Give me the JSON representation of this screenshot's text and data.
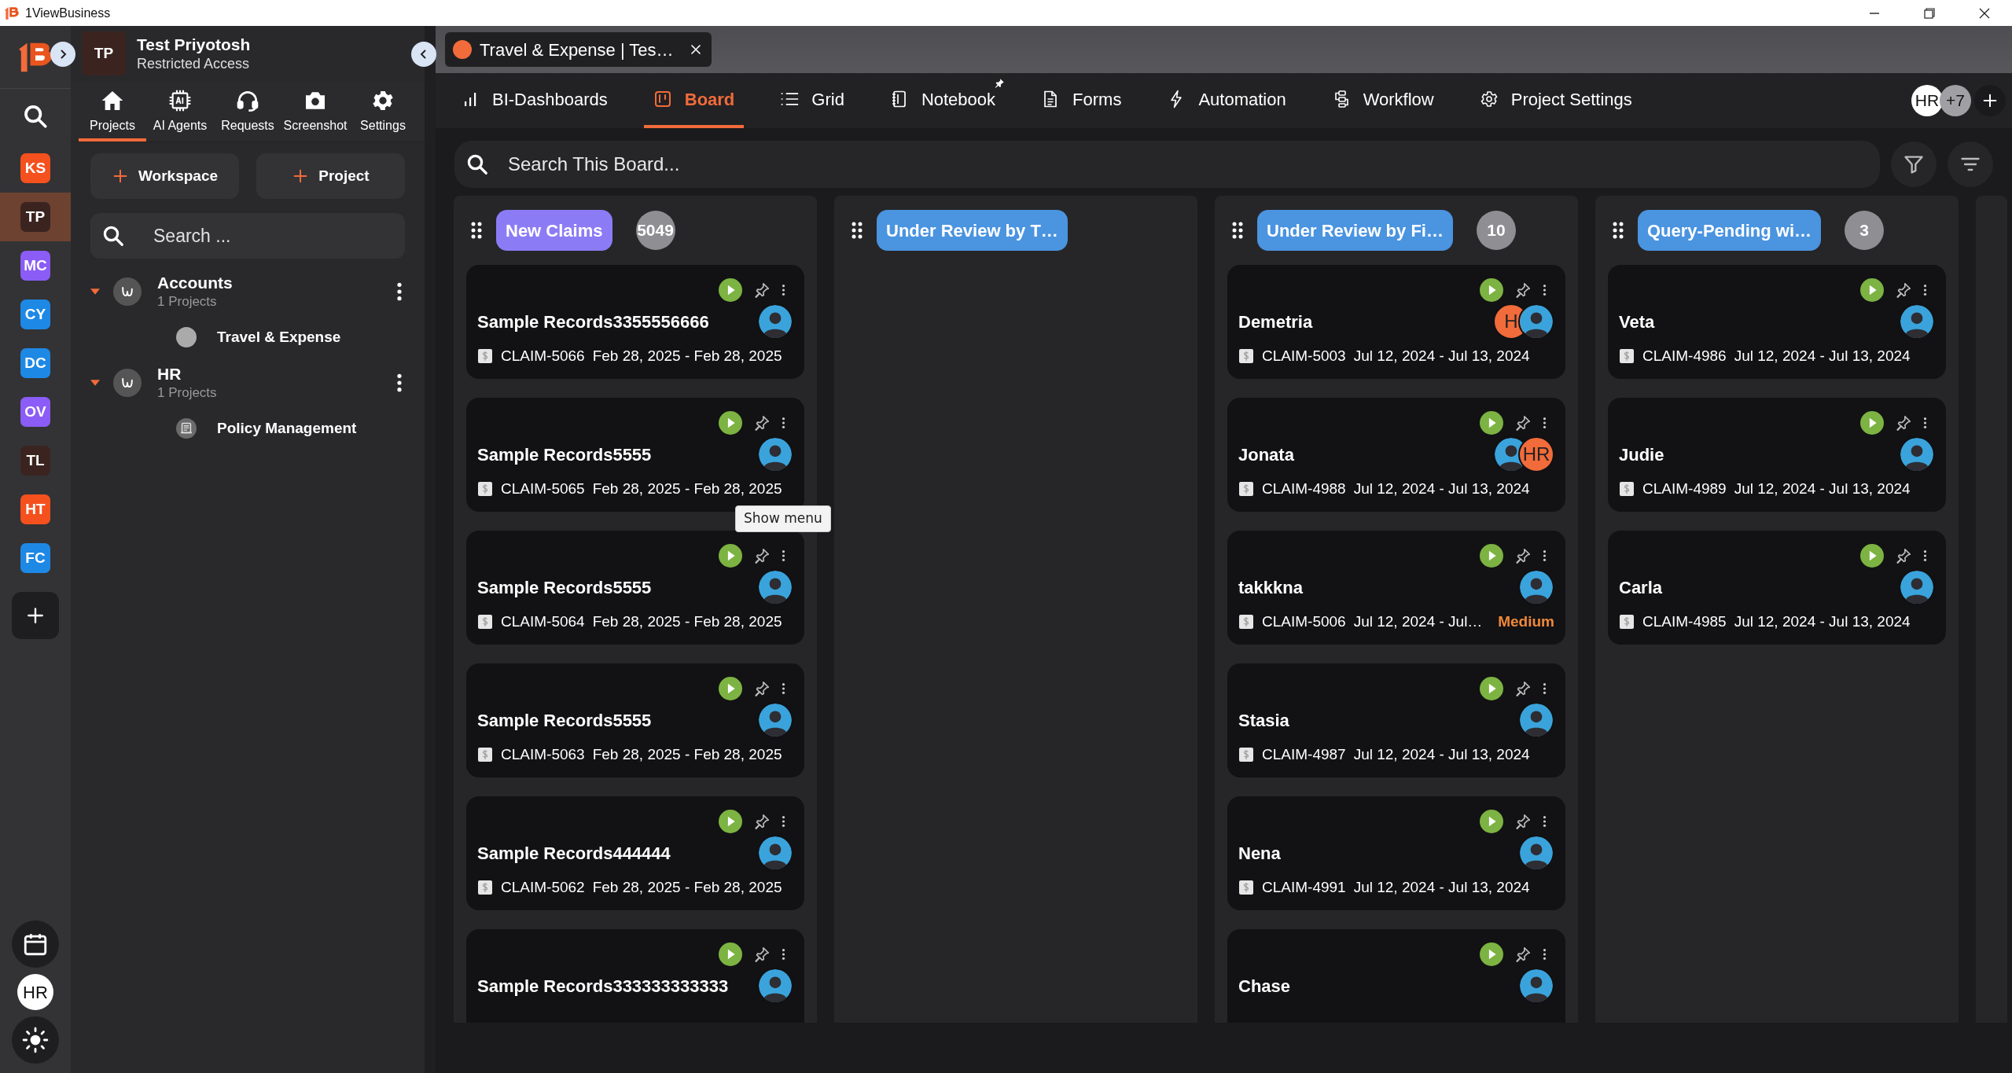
{
  "window": {
    "title": "1ViewBusiness"
  },
  "rail": {
    "items": [
      {
        "initials": "KS",
        "color": "#f4511e",
        "selected": false
      },
      {
        "initials": "TP",
        "color": "#3b2420",
        "selected": true
      },
      {
        "initials": "MC",
        "color": "#8b5cf6",
        "selected": false
      },
      {
        "initials": "CY",
        "color": "#1e88e5",
        "selected": false
      },
      {
        "initials": "DC",
        "color": "#1e88e5",
        "selected": false
      },
      {
        "initials": "OV",
        "color": "#8b5cf6",
        "selected": false
      },
      {
        "initials": "TL",
        "color": "#3b2420",
        "selected": false
      },
      {
        "initials": "HT",
        "color": "#f4511e",
        "selected": false
      },
      {
        "initials": "FC",
        "color": "#1e88e5",
        "selected": false
      }
    ],
    "user": "HR"
  },
  "panel": {
    "avatar": "TP",
    "name": "Test Priyotosh",
    "role": "Restricted Access",
    "tabs": [
      {
        "label": "Projects",
        "selected": true
      },
      {
        "label": "AI Agents",
        "selected": false
      },
      {
        "label": "Requests",
        "selected": false
      },
      {
        "label": "Screenshot",
        "selected": false
      },
      {
        "label": "Settings",
        "selected": false
      }
    ],
    "buttons": [
      "Workspace",
      "Project"
    ],
    "search": {
      "placeholder": "Search ..."
    },
    "workspaces": [
      {
        "name": "Accounts",
        "count": "1 Projects",
        "expanded": true,
        "children": [
          {
            "name": "Travel & Expense",
            "kind": "dot"
          }
        ]
      },
      {
        "name": "HR",
        "count": "1 Projects",
        "expanded": true,
        "children": [
          {
            "name": "Policy Management",
            "kind": "scroll"
          }
        ]
      }
    ]
  },
  "doc_tab": {
    "title": "Travel & Expense | Tes…"
  },
  "nav": [
    {
      "label": "BI-Dashboards",
      "selected": false
    },
    {
      "label": "Board",
      "selected": true
    },
    {
      "label": "Grid",
      "selected": false
    },
    {
      "label": "Notebook",
      "selected": false,
      "pinned": true
    },
    {
      "label": "Forms",
      "selected": false
    },
    {
      "label": "Automation",
      "selected": false
    },
    {
      "label": "Workflow",
      "selected": false
    },
    {
      "label": "Project Settings",
      "selected": false
    }
  ],
  "members": {
    "first": "HR",
    "more": "+7"
  },
  "board_search": {
    "placeholder": "Search This Board..."
  },
  "columns": [
    {
      "title": "New Claims",
      "color": "#8b7cf6",
      "count": "5049",
      "cards": [
        {
          "title": "Sample Records3355556666",
          "claim": "CLAIM-5066",
          "dates": "Feb 28, 2025 - Feb 28, 2025",
          "assignees": [
            {
              "kind": "photo"
            }
          ]
        },
        {
          "title": "Sample Records5555",
          "claim": "CLAIM-5065",
          "dates": "Feb 28, 2025 - Feb 28, 2025",
          "assignees": [
            {
              "kind": "photo"
            }
          ]
        },
        {
          "title": "Sample Records5555",
          "claim": "CLAIM-5064",
          "dates": "Feb 28, 2025 - Feb 28, 2025",
          "assignees": [
            {
              "kind": "photo"
            }
          ]
        },
        {
          "title": "Sample Records5555",
          "claim": "CLAIM-5063",
          "dates": "Feb 28, 2025 - Feb 28, 2025",
          "assignees": [
            {
              "kind": "photo"
            }
          ]
        },
        {
          "title": "Sample Records444444",
          "claim": "CLAIM-5062",
          "dates": "Feb 28, 2025 - Feb 28, 2025",
          "assignees": [
            {
              "kind": "photo"
            }
          ]
        },
        {
          "title": "Sample Records333333333333",
          "assignees": [
            {
              "kind": "photo"
            }
          ]
        }
      ]
    },
    {
      "title": "Under Review by T…",
      "color": "#4a94e0"
    },
    {
      "title": "Under Review by Fi…",
      "color": "#4a94e0",
      "count": "10",
      "cards": [
        {
          "title": "Demetria",
          "claim": "CLAIM-5003",
          "dates": "Jul 12, 2024 - Jul 13, 2024",
          "assignees": [
            {
              "kind": "initials",
              "text": "H"
            },
            {
              "kind": "photo"
            }
          ]
        },
        {
          "title": "Jonata",
          "claim": "CLAIM-4988",
          "dates": "Jul 12, 2024 - Jul 13, 2024",
          "assignees": [
            {
              "kind": "photo"
            },
            {
              "kind": "initials",
              "text": "HR"
            }
          ]
        },
        {
          "title": "takkkna",
          "claim": "CLAIM-5006",
          "dates": "Jul 12, 2024 - Jul…",
          "priority": "Medium",
          "assignees": [
            {
              "kind": "photo"
            }
          ]
        },
        {
          "title": "Stasia",
          "claim": "CLAIM-4987",
          "dates": "Jul 12, 2024 - Jul 13, 2024",
          "assignees": [
            {
              "kind": "photo"
            }
          ]
        },
        {
          "title": "Nena",
          "claim": "CLAIM-4991",
          "dates": "Jul 12, 2024 - Jul 13, 2024",
          "assignees": [
            {
              "kind": "photo"
            }
          ]
        },
        {
          "title": "Chase",
          "assignees": [
            {
              "kind": "photo"
            }
          ]
        }
      ]
    },
    {
      "title": "Query-Pending wi…",
      "color": "#4a94e0",
      "count": "3",
      "cards": [
        {
          "title": "Veta",
          "claim": "CLAIM-4986",
          "dates": "Jul 12, 2024 - Jul 13, 2024",
          "assignees": [
            {
              "kind": "photo"
            }
          ]
        },
        {
          "title": "Judie",
          "claim": "CLAIM-4989",
          "dates": "Jul 12, 2024 - Jul 13, 2024",
          "assignees": [
            {
              "kind": "photo"
            }
          ]
        },
        {
          "title": "Carla",
          "claim": "CLAIM-4985",
          "dates": "Jul 12, 2024 - Jul 13, 2024",
          "assignees": [
            {
              "kind": "photo"
            }
          ]
        }
      ]
    }
  ],
  "tooltip": "Show menu"
}
